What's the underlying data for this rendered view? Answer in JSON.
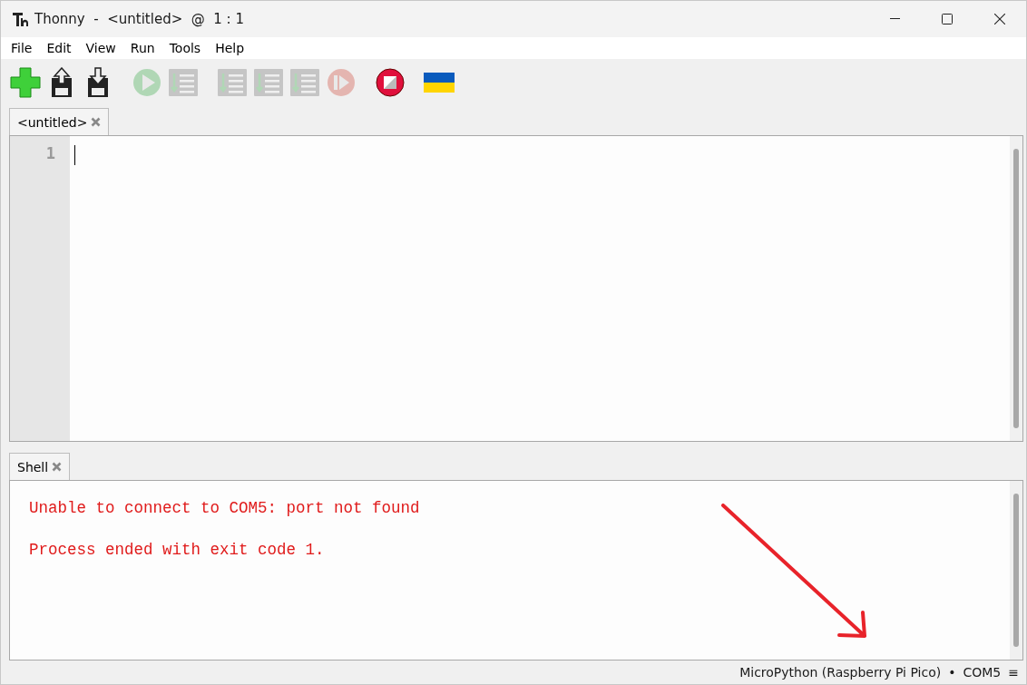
{
  "window": {
    "title": "Thonny  -  <untitled>  @  1 : 1"
  },
  "menu": [
    "File",
    "Edit",
    "View",
    "Run",
    "Tools",
    "Help"
  ],
  "toolbar": [
    {
      "kind": "new",
      "disabled": false
    },
    {
      "kind": "load",
      "disabled": false
    },
    {
      "kind": "save",
      "disabled": false
    },
    {
      "kind": "run",
      "disabled": true
    },
    {
      "kind": "debug",
      "disabled": true
    },
    {
      "kind": "over",
      "disabled": true
    },
    {
      "kind": "into",
      "disabled": true
    },
    {
      "kind": "out",
      "disabled": true
    },
    {
      "kind": "resume",
      "disabled": true
    },
    {
      "kind": "stop",
      "disabled": false
    },
    {
      "kind": "flag",
      "disabled": false
    }
  ],
  "editor": {
    "tab": "<untitled>",
    "line_numbers": [
      "1"
    ]
  },
  "shell": {
    "tab": "Shell",
    "lines": [
      "Unable to connect to COM5: port not found",
      "Process ended with exit code 1."
    ]
  },
  "status_bar": {
    "interpreter": "MicroPython (Raspberry Pi Pico)",
    "separator": "•",
    "port": "COM5",
    "menu_glyph": "≡"
  }
}
